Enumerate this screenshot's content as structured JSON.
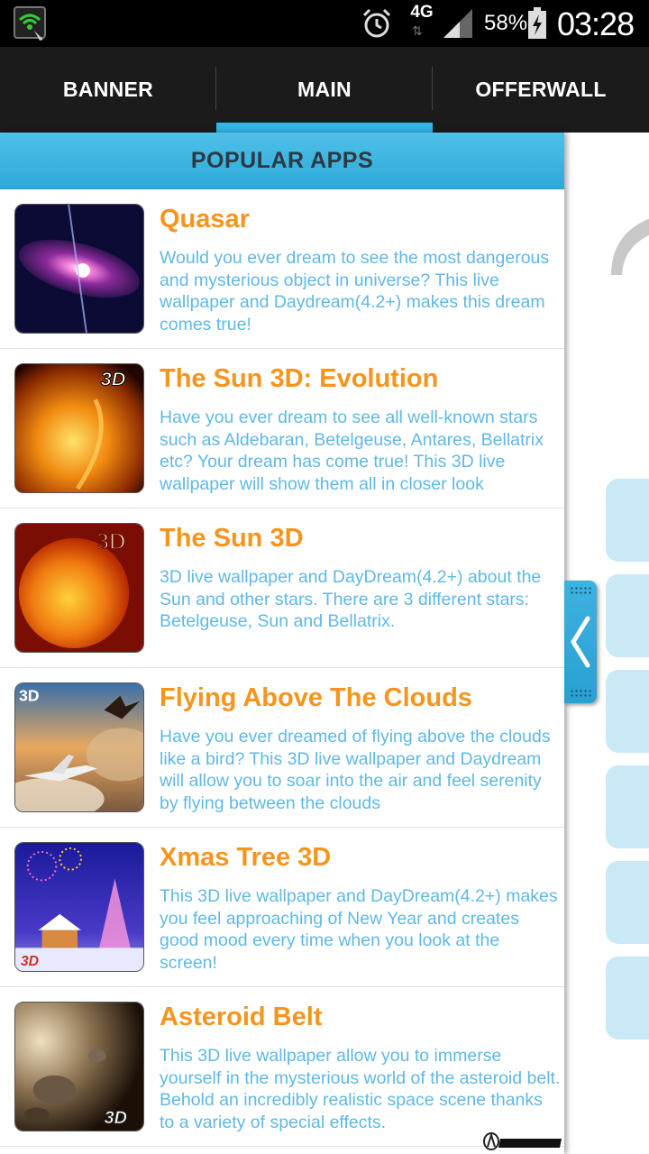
{
  "status_bar": {
    "network": "4G",
    "battery": "58%",
    "time": "03:28"
  },
  "tabs": [
    {
      "label": "BANNER",
      "active": false
    },
    {
      "label": "MAIN",
      "active": true
    },
    {
      "label": "OFFERWALL",
      "active": false
    }
  ],
  "section": {
    "title": "POPULAR APPS"
  },
  "apps": [
    {
      "title": "Quasar",
      "description": "Would you ever dream to see the most dangerous and mysterious object in universe? This live wallpaper and Daydream(4.2+) makes this dream comes true!",
      "icon": "quasar-icon"
    },
    {
      "title": "The Sun 3D: Evolution",
      "description": "Have you ever dream to see all well-known stars such as Aldebaran, Betelgeuse, Antares, Bellatrix etc? Your dream has come true! This 3D live wallpaper will show them all in closer look",
      "icon": "sun-evolution-icon"
    },
    {
      "title": "The Sun 3D",
      "description": "3D live wallpaper and DayDream(4.2+) about the Sun and other stars. There are 3 different stars: Betelgeuse, Sun and Bellatrix.",
      "icon": "sun-icon"
    },
    {
      "title": "Flying Above The Clouds",
      "description": "Have you ever dreamed of flying above the clouds like a bird? This 3D live wallpaper and Daydream will allow you to soar into the air and feel serenity by flying between the clouds",
      "icon": "plane-icon"
    },
    {
      "title": "Xmas Tree 3D",
      "description": "This 3D live wallpaper and DayDream(4.2+) makes you feel approaching of New Year and creates good mood every time when you look at the screen!",
      "icon": "xmas-tree-icon"
    },
    {
      "title": "Asteroid Belt",
      "description": "This 3D live wallpaper allow you to immerse yourself in the mysterious world of the asteroid belt. Behold an incredibly realistic space scene thanks to a variety of special effects.",
      "icon": "asteroid-icon"
    }
  ],
  "thumb_badges": {
    "three_d": "3D"
  },
  "colors": {
    "accent": "#33b5e5",
    "title": "#f7941d",
    "description": "#5fb8e6",
    "header_text": "#2b3a44"
  }
}
